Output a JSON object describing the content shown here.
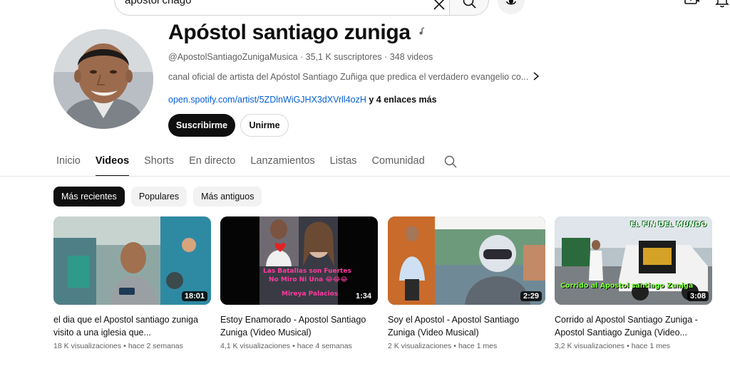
{
  "search": {
    "query": "apostol chago"
  },
  "channel": {
    "name": "Apóstol santiago zuniga",
    "handle": "@ApostolSantiagoZunigaMusica",
    "subscribers": "35,1 K suscriptores",
    "video_count": "348 videos",
    "description": "canal oficial de artista del Apóstol Santiago Zuñiga que predica el verdadero evangelio co...",
    "link": "open.spotify.com/artist/5ZDlnWiGJHX3dXVrll4ozH",
    "more_links": "y 4 enlaces más",
    "subscribe_label": "Suscribirme",
    "join_label": "Unirme"
  },
  "tabs": [
    {
      "label": "Inicio",
      "active": false
    },
    {
      "label": "Videos",
      "active": true
    },
    {
      "label": "Shorts",
      "active": false
    },
    {
      "label": "En directo",
      "active": false
    },
    {
      "label": "Lanzamientos",
      "active": false
    },
    {
      "label": "Listas",
      "active": false
    },
    {
      "label": "Comunidad",
      "active": false
    }
  ],
  "chips": [
    {
      "label": "Más recientes",
      "active": true
    },
    {
      "label": "Populares",
      "active": false
    },
    {
      "label": "Más antiguos",
      "active": false
    }
  ],
  "videos": [
    {
      "title": "el dia que el Apostol santiago zuniga visito a una iglesia que...",
      "duration": "18:01",
      "views": "18 K visualizaciones",
      "age": "hace 2 semanas"
    },
    {
      "title": "Estoy Enamorado - Apostol Santiago Zuniga (Video Musical)",
      "duration": "1:34",
      "views": "4,1 K visualizaciones",
      "age": "hace 4 semanas",
      "overlay_lines": [
        "Las Batallas son Fuertes",
        "No Miro Ni Una 😂😂😂",
        "Mireya Palacios"
      ]
    },
    {
      "title": "Soy el Apostol - Apostol Santiago Zuniga (Video Musical)",
      "duration": "2:29",
      "views": "2 K visualizaciones",
      "age": "hace 1 mes"
    },
    {
      "title": "Corrido al Apostol Santiago Zuniga - Apostol Santiago Zuniga (Video...",
      "duration": "3:08",
      "views": "3,2 K visualizaciones",
      "age": "hace 1 mes",
      "overlay_top": "EL FIN DEL MUNDO",
      "overlay_bottom": "Corrido al Apostol santiago Zuniga"
    }
  ],
  "meta_separator": "•",
  "colors": {
    "text_primary": "#0f0f0f",
    "text_secondary": "#606060",
    "link": "#065fd4",
    "chip_bg": "#f2f2f2"
  }
}
